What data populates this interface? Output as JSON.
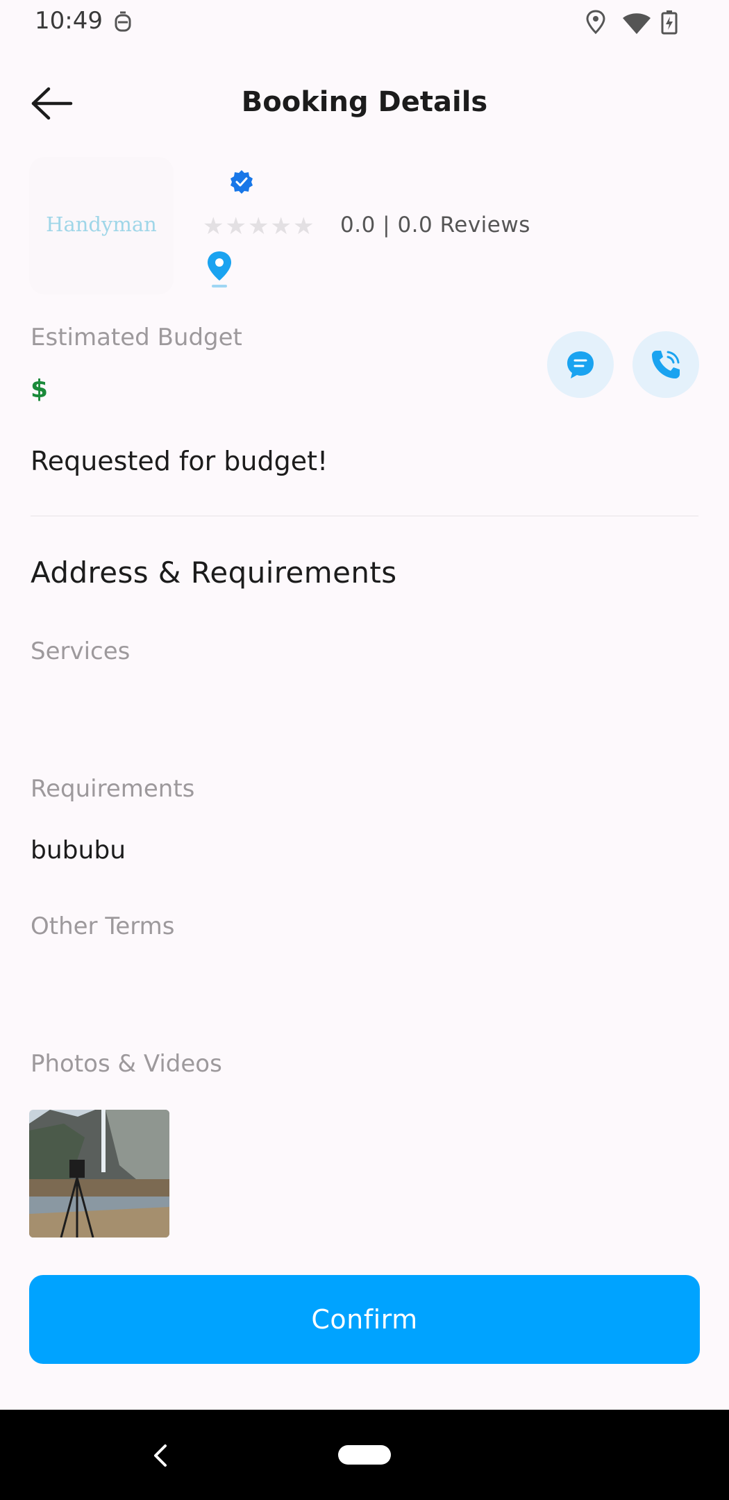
{
  "status_bar": {
    "time": "10:49"
  },
  "app_bar": {
    "title": "Booking Details"
  },
  "provider": {
    "logo_text": "Handyman",
    "rating_text": "0.0 | 0.0 Reviews",
    "stars_filled": 0,
    "stars_total": 5
  },
  "budget": {
    "label": "Estimated Budget",
    "currency": "$",
    "status": "Requested for budget!"
  },
  "address_section": {
    "title": "Address & Requirements",
    "services_label": "Services",
    "requirements_label": "Requirements",
    "requirements_value": "bububu",
    "other_terms_label": "Other Terms",
    "photos_label": "Photos & Videos"
  },
  "actions": {
    "confirm_label": "Confirm"
  },
  "colors": {
    "accent": "#00a3ff",
    "verified": "#1877e8",
    "price": "#1a8a3a",
    "circle_bg": "#e4f1fb"
  },
  "icons": [
    "back-arrow-icon",
    "verified-badge-icon",
    "star-icon",
    "location-pin-icon",
    "chat-icon",
    "phone-icon",
    "nav-back-icon",
    "nav-home-icon"
  ]
}
